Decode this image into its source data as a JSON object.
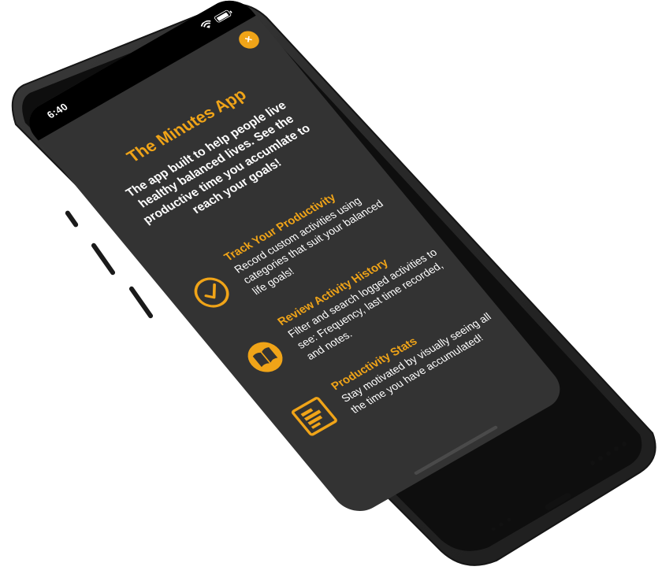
{
  "status_bar": {
    "time": "6:40",
    "icons": [
      "wifi-icon",
      "battery-icon"
    ]
  },
  "close_button": {
    "label": "×"
  },
  "app": {
    "title": "The Minutes App",
    "subtitle": "The app built to help people live healthy balanced lives. See the productive time you accumlate to reach your goals!"
  },
  "features": [
    {
      "icon": "checkmark-circle-icon",
      "title": "Track Your Productivity",
      "description": "Record custom activities using categories that suit your balanced life goals!"
    },
    {
      "icon": "book-icon",
      "title": "Review Activity History",
      "description": "Filter and search logged activities to see: Frequency, last time recorded, and notes."
    },
    {
      "icon": "stats-chart-icon",
      "title": "Productivity Stats",
      "description": "Stay motivated by visually seeing all the time you have accumulated!"
    }
  ],
  "colors": {
    "accent": "#f0a418",
    "screen_background": "#333333",
    "device_body": "#2a2a2a",
    "text": "#ffffff"
  }
}
